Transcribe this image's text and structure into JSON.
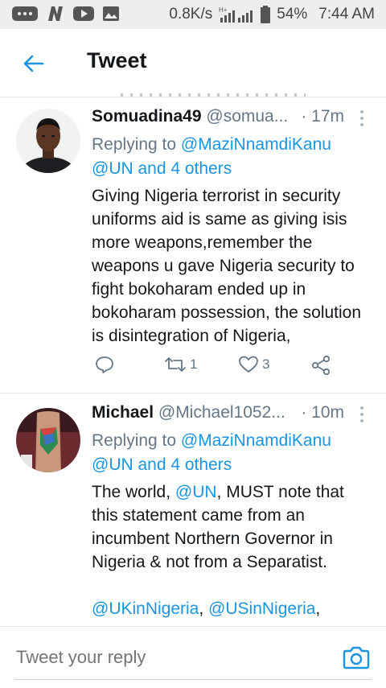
{
  "status_bar": {
    "speed": "0.8K/s",
    "network": "H+",
    "battery": "54%",
    "time": "7:44 AM"
  },
  "header": {
    "title": "Tweet"
  },
  "tweets": [
    {
      "name": "Somuadina49",
      "handle": "@somua...",
      "time": "· 17m",
      "replying_prefix": "Replying to ",
      "replying_mention": "@MaziNnamdiKanu",
      "replying_others": "@UN and 4 others",
      "body": "Giving Nigeria terrorist in security uniforms aid is same as giving isis more weapons,remember the weapons u gave Nigeria security to fight bokoharam ended up in bokoharam possession, the solution is disintegration of Nigeria,",
      "retweets": "1",
      "likes": "3"
    },
    {
      "name": "Michael",
      "handle": "@Michael1052...",
      "time": "· 10m",
      "replying_prefix": "Replying to ",
      "replying_mention": "@MaziNnamdiKanu",
      "replying_others": "@UN and 4 others",
      "body_part1": "The world, ",
      "body_mention": "@UN",
      "body_part2": ", MUST note that this statement came from an incumbent Northern Governor in Nigeria & not from a Separatist.",
      "mention_line_1": "@UKinNigeria",
      "mention_sep": ", ",
      "mention_line_2": "@USinNigeria",
      "mention_end": ","
    }
  ],
  "reply_bar": {
    "placeholder": "Tweet your reply"
  },
  "colors": {
    "accent": "#1b95e0",
    "muted": "#657786",
    "divider": "#e6ecf0"
  }
}
